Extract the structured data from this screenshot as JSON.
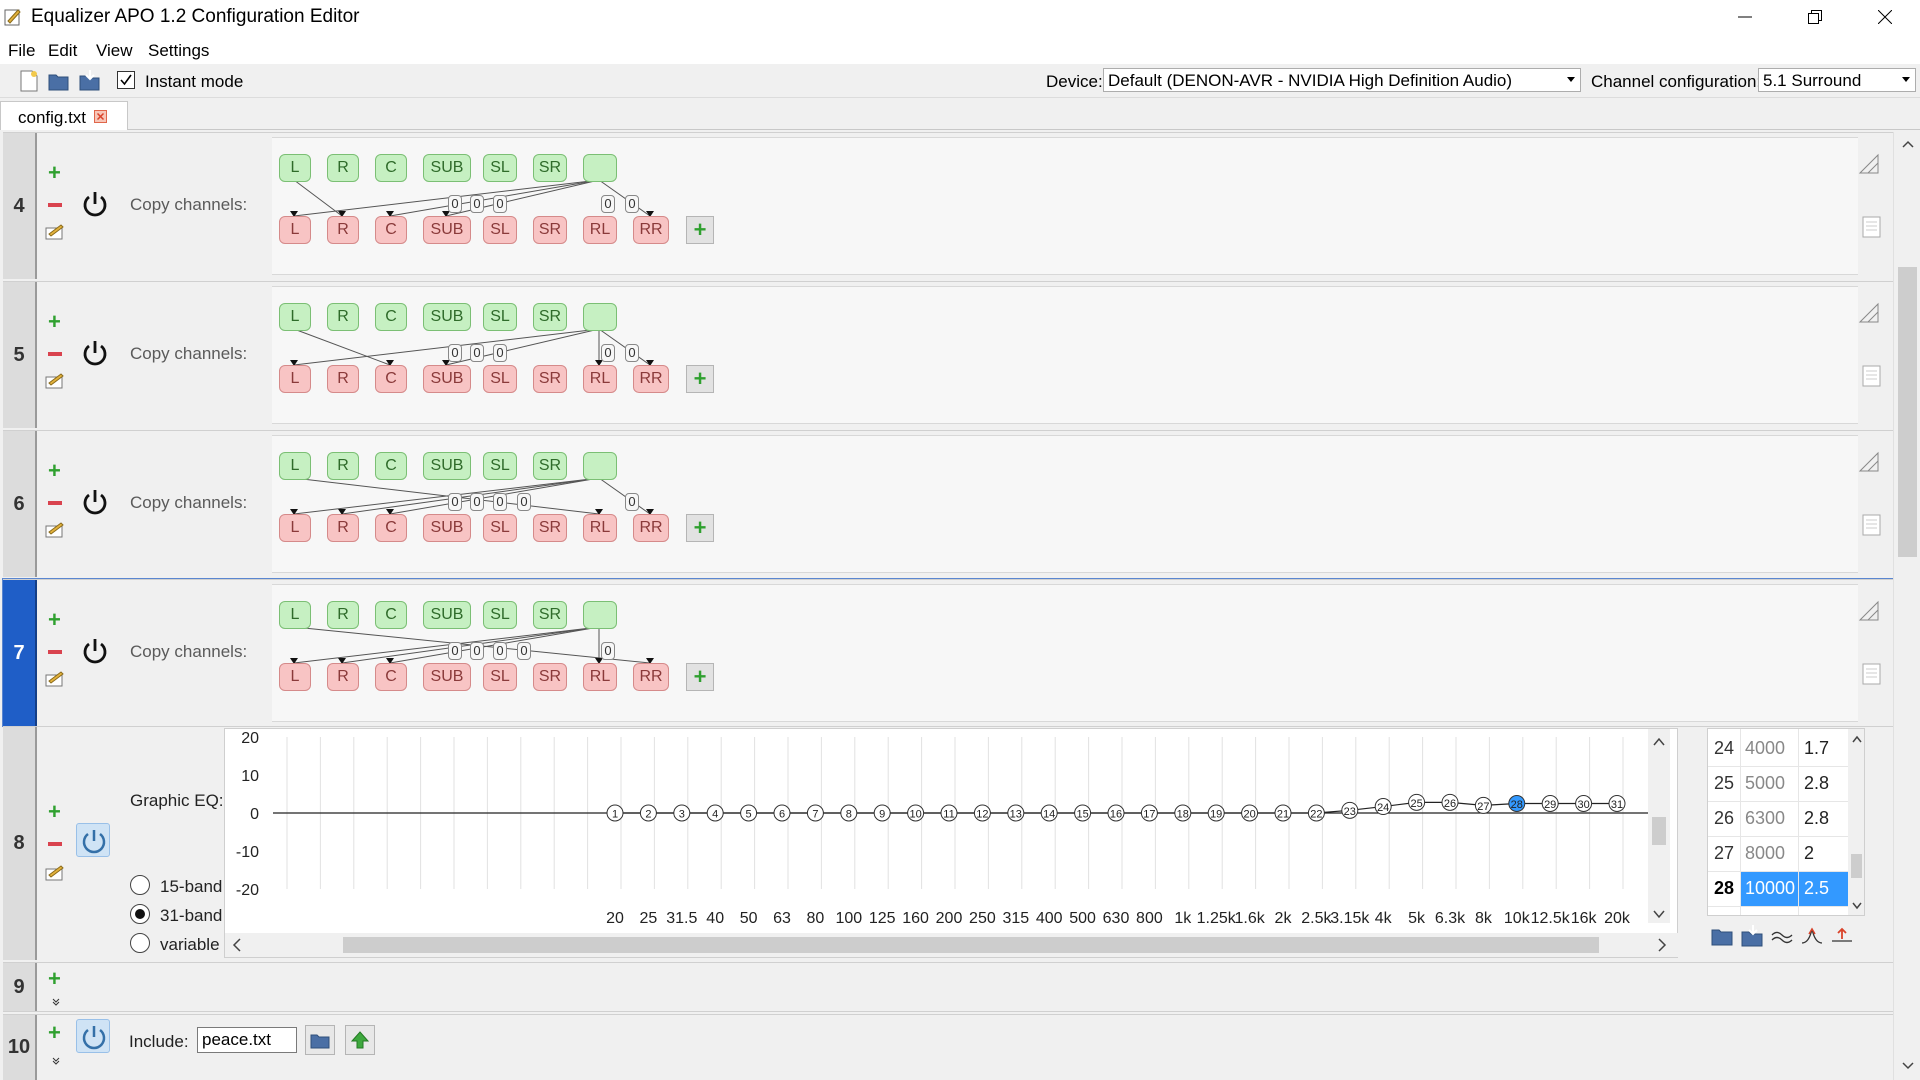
{
  "window": {
    "title": "Equalizer APO 1.2 Configuration Editor"
  },
  "menu": [
    "File",
    "Edit",
    "View",
    "Settings"
  ],
  "toolbar": {
    "instant_mode_label": "Instant mode",
    "instant_mode_checked": true,
    "device_label": "Device:",
    "device_value": "Default (DENON-AVR - NVIDIA High Definition Audio)",
    "channel_config_label": "Channel configuration:",
    "channel_config_value": "5.1 Surround"
  },
  "tab": {
    "label": "config.txt"
  },
  "copy_rows": [
    {
      "number": "4",
      "label": "Copy channels:",
      "sources": [
        "L",
        "R",
        "C",
        "SUB",
        "SL",
        "SR",
        ""
      ],
      "targets": [
        "L",
        "R",
        "C",
        "SUB",
        "SL",
        "SR",
        "RL",
        "RR"
      ],
      "gains": [
        "0",
        "0",
        "0",
        "0",
        "0"
      ]
    },
    {
      "number": "5",
      "label": "Copy channels:",
      "sources": [
        "L",
        "R",
        "C",
        "SUB",
        "SL",
        "SR",
        ""
      ],
      "targets": [
        "L",
        "R",
        "C",
        "SUB",
        "SL",
        "SR",
        "RL",
        "RR"
      ],
      "gains": [
        "0",
        "0",
        "0",
        "0",
        "0"
      ]
    },
    {
      "number": "6",
      "label": "Copy channels:",
      "sources": [
        "L",
        "R",
        "C",
        "SUB",
        "SL",
        "SR",
        ""
      ],
      "targets": [
        "L",
        "R",
        "C",
        "SUB",
        "SL",
        "SR",
        "RL",
        "RR"
      ],
      "gains": [
        "0",
        "0",
        "0",
        "0",
        "0"
      ]
    },
    {
      "number": "7",
      "label": "Copy channels:",
      "sources": [
        "L",
        "R",
        "C",
        "SUB",
        "SL",
        "SR",
        ""
      ],
      "targets": [
        "L",
        "R",
        "C",
        "SUB",
        "SL",
        "SR",
        "RL",
        "RR"
      ],
      "gains": [
        "0",
        "0",
        "0",
        "0",
        "0"
      ]
    }
  ],
  "eq_row": {
    "number": "8",
    "label": "Graphic EQ:",
    "modes": [
      "15-band",
      "31-band",
      "variable"
    ],
    "selected_mode": "31-band",
    "y_ticks": [
      "20",
      "10",
      "0",
      "-10",
      "-20"
    ],
    "x_ticks": [
      "20",
      "25",
      "31.5",
      "40",
      "50",
      "63",
      "80",
      "100",
      "125",
      "160",
      "200",
      "250",
      "315",
      "400",
      "500",
      "630",
      "800",
      "1k",
      "1.25k",
      "1.6k",
      "2k",
      "2.5k",
      "3.15k",
      "4k",
      "5k",
      "6.3k",
      "8k",
      "10k",
      "12.5k",
      "16k",
      "20k"
    ],
    "band_gains": [
      0,
      0,
      0,
      0,
      0,
      0,
      0,
      0,
      0,
      0,
      0,
      0,
      0,
      0,
      0,
      0,
      0,
      0,
      0,
      0,
      0,
      0,
      0.7,
      1.7,
      2.8,
      2.8,
      2,
      2.5,
      2.5,
      2.5,
      2.5
    ],
    "selected_band": 28,
    "table": [
      {
        "band": "24",
        "freq": "4000",
        "gain": "1.7"
      },
      {
        "band": "25",
        "freq": "5000",
        "gain": "2.8"
      },
      {
        "band": "26",
        "freq": "6300",
        "gain": "2.8"
      },
      {
        "band": "27",
        "freq": "8000",
        "gain": "2"
      },
      {
        "band": "28",
        "freq": "10000",
        "gain": "2.5"
      }
    ]
  },
  "row9": {
    "number": "9"
  },
  "row10": {
    "number": "10",
    "label": "Include:",
    "file": "peace.txt"
  },
  "colors": {
    "selected_row": "#1f5ec7",
    "source_channel": "#c6f0c2",
    "target_channel": "#f8c4c4",
    "selection": "#3399ff"
  }
}
